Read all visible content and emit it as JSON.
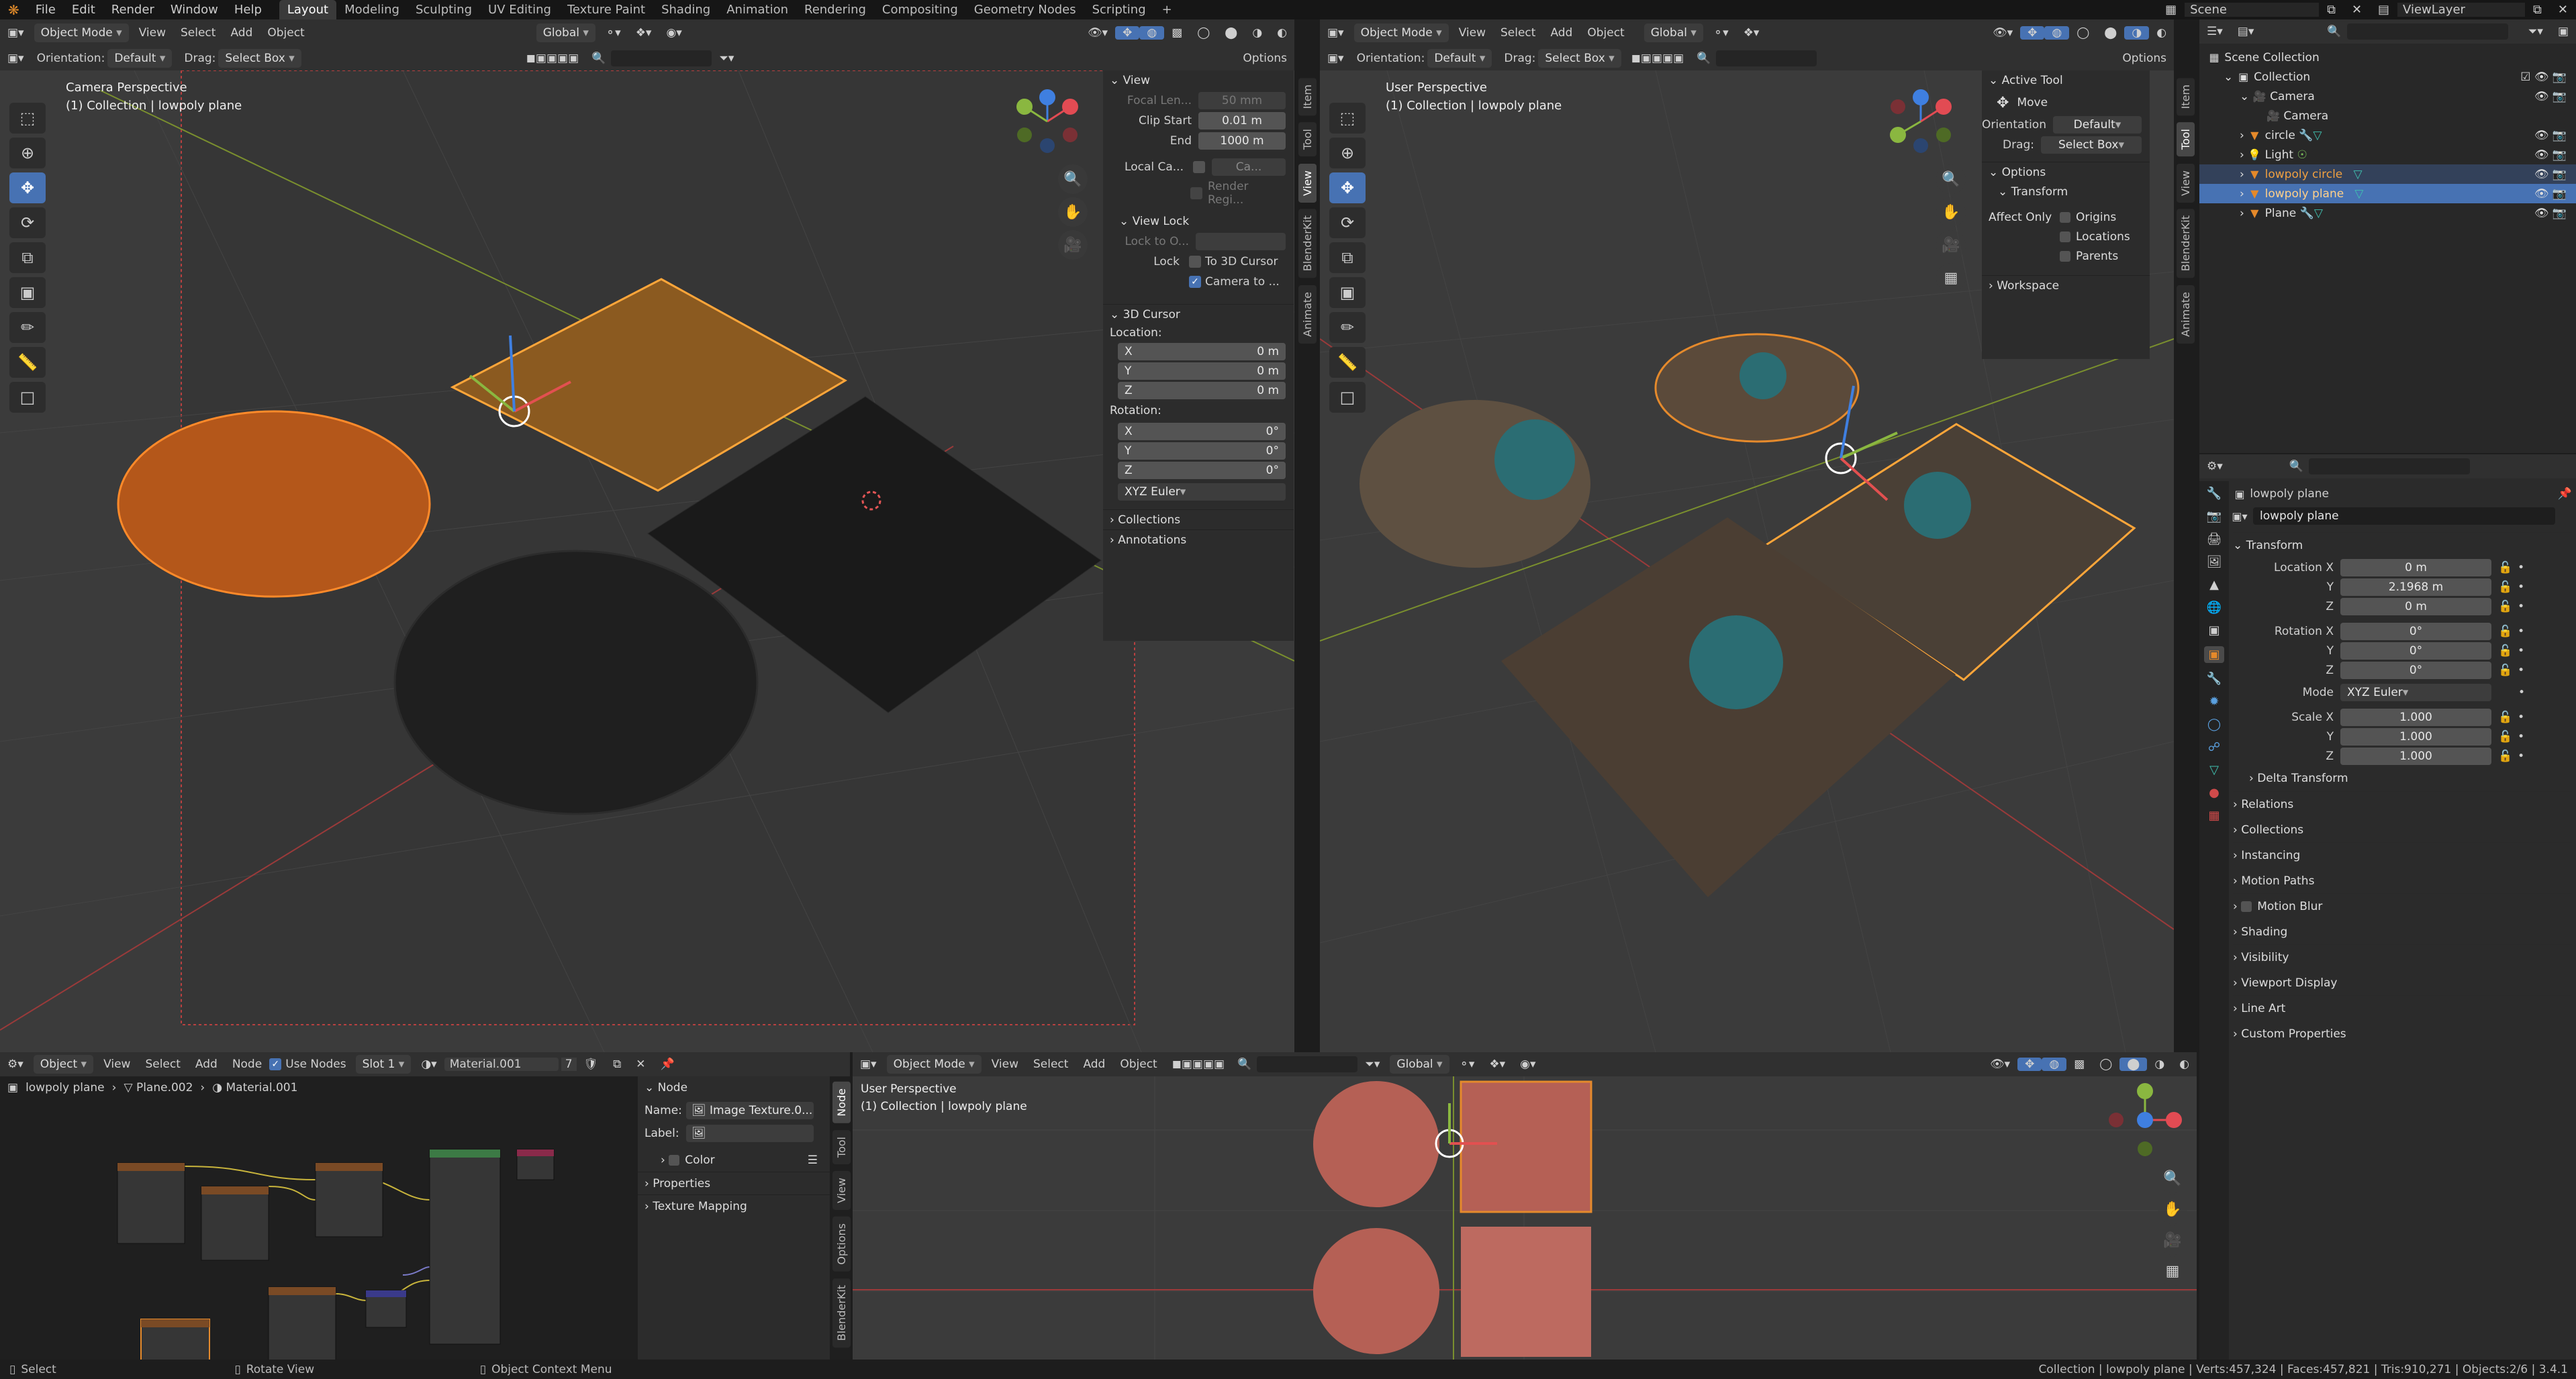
{
  "topbar": {
    "menus": [
      "File",
      "Edit",
      "Render",
      "Window",
      "Help"
    ],
    "workspaces": [
      "Layout",
      "Modeling",
      "Sculpting",
      "UV Editing",
      "Texture Paint",
      "Shading",
      "Animation",
      "Rendering",
      "Compositing",
      "Geometry Nodes",
      "Scripting"
    ],
    "add_tab": "+",
    "scene": "Scene",
    "viewlayer": "ViewLayer"
  },
  "vp_left": {
    "mode": "Object Mode",
    "menus": [
      "View",
      "Select",
      "Add",
      "Object"
    ],
    "transform": "Global",
    "orientation_label": "Orientation:",
    "orientation": "Default",
    "drag_label": "Drag:",
    "drag": "Select Box",
    "options": "Options",
    "overlay_title": "Camera Perspective",
    "overlay_sub": "(1) Collection | lowpoly plane",
    "npanel": {
      "view_header": "View",
      "focal_label": "Focal Len...",
      "focal": "50 mm",
      "clip_start_label": "Clip Start",
      "clip_start": "0.01 m",
      "end_label": "End",
      "end": "1000 m",
      "local_cam_label": "Local Ca...",
      "local_cam": "Ca...",
      "render_region": "Render Regi...",
      "view_lock": "View Lock",
      "lock_to": "Lock to O...",
      "lock_label": "Lock",
      "to_3d_cursor": "To 3D Cursor",
      "camera_to": "Camera to ...",
      "cursor_header": "3D Cursor",
      "location": "Location:",
      "rotation": "Rotation:",
      "loc_x": "0 m",
      "loc_y": "0 m",
      "loc_z": "0 m",
      "rot_x": "0°",
      "rot_y": "0°",
      "rot_z": "0°",
      "euler": "XYZ Euler",
      "collections": "Collections",
      "annotations": "Annotations",
      "axes": [
        "X",
        "Y",
        "Z"
      ]
    },
    "tabs": [
      "Item",
      "Tool",
      "View",
      "BlenderKit",
      "Animate"
    ]
  },
  "vp_right": {
    "mode": "Object Mode",
    "menus": [
      "View",
      "Select",
      "Add",
      "Object"
    ],
    "transform": "Global",
    "orientation_label": "Orientation:",
    "orientation": "Default",
    "drag_label": "Drag:",
    "drag": "Select Box",
    "options": "Options",
    "overlay_title": "User Perspective",
    "overlay_sub": "(1) Collection | lowpoly plane",
    "npanel": {
      "active_tool": "Active Tool",
      "move": "Move",
      "orientation_label": "Orientation",
      "orientation": "Default",
      "drag_label": "Drag:",
      "drag": "Select Box",
      "options": "Options",
      "transform": "Transform",
      "affect_only": "Affect Only",
      "origins": "Origins",
      "locations": "Locations",
      "parents": "Parents",
      "workspace": "Workspace"
    },
    "tabs": [
      "Item",
      "Tool",
      "View",
      "BlenderKit",
      "Animate"
    ]
  },
  "outliner": {
    "scene_collection": "Scene Collection",
    "items": [
      {
        "name": "Collection",
        "depth": 1
      },
      {
        "name": "Camera",
        "depth": 2
      },
      {
        "name": "Camera",
        "depth": 3
      },
      {
        "name": "circle",
        "depth": 2
      },
      {
        "name": "Light",
        "depth": 2
      },
      {
        "name": "lowpoly circle",
        "depth": 2
      },
      {
        "name": "lowpoly plane",
        "depth": 2
      },
      {
        "name": "Plane",
        "depth": 2
      }
    ]
  },
  "properties": {
    "object_name": "lowpoly plane",
    "object_field": "lowpoly plane",
    "transform": "Transform",
    "location_x_label": "Location X",
    "location_x": "0 m",
    "y_label": "Y",
    "location_y": "2.1968 m",
    "z_label": "Z",
    "location_z": "0 m",
    "rotation_x_label": "Rotation X",
    "rotation_x": "0°",
    "rotation_y": "0°",
    "rotation_z": "0°",
    "mode_label": "Mode",
    "mode": "XYZ Euler",
    "scale_x_label": "Scale X",
    "scale_x": "1.000",
    "scale_y": "1.000",
    "scale_z": "1.000",
    "delta": "Delta Transform",
    "sections": [
      "Relations",
      "Collections",
      "Instancing",
      "Motion Paths",
      "Motion Blur",
      "Shading",
      "Visibility",
      "Viewport Display",
      "Line Art",
      "Custom Properties"
    ]
  },
  "node_editor": {
    "editor": "Object",
    "menus": [
      "View",
      "Select",
      "Add",
      "Node"
    ],
    "use_nodes": "Use Nodes",
    "slot": "Slot 1",
    "material": "Material.001",
    "users": "7",
    "breadcrumb": [
      "lowpoly plane",
      "Plane.002",
      "Material.001"
    ],
    "panel": {
      "node": "Node",
      "name_label": "Name:",
      "name": "Image Texture.0...",
      "label_label": "Label:",
      "color": "Color",
      "properties": "Properties",
      "texture_mapping": "Texture Mapping"
    },
    "tabs": [
      "Node",
      "Tool",
      "View",
      "Options",
      "BlenderKit"
    ]
  },
  "vp_bottom": {
    "mode": "Object Mode",
    "menus": [
      "View",
      "Select",
      "Add",
      "Object"
    ],
    "transform": "Global",
    "overlay_title": "User Perspective",
    "overlay_sub": "(1) Collection | lowpoly plane"
  },
  "status": {
    "select": "Select",
    "rotate": "Rotate View",
    "context": "Object Context Menu",
    "info": "Collection | lowpoly plane | Verts:457,324 | Faces:457,821 | Tris:910,271 | Objects:2/6 | 3.4.1"
  },
  "colors": {
    "accent": "#4772b3",
    "selected_orange": "#e58a2c",
    "x_axis": "#e24b53",
    "y_axis": "#8ab740",
    "z_axis": "#3f7fe0",
    "terracotta": "#c06a5d"
  }
}
